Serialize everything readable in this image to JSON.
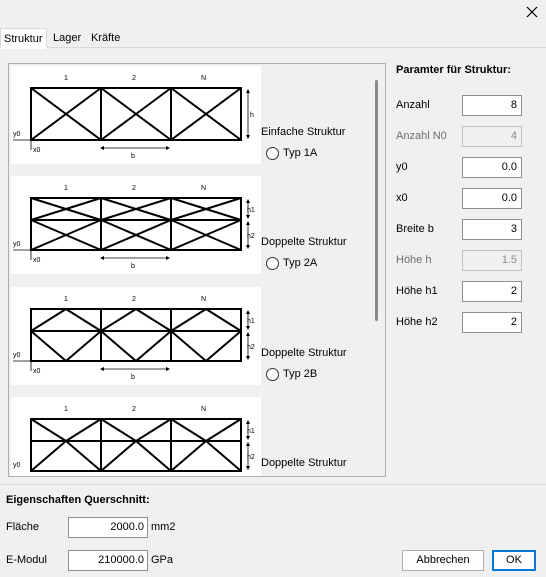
{
  "tabs": [
    {
      "label": "Struktur",
      "active": true
    },
    {
      "label": "Lager",
      "active": false
    },
    {
      "label": "Kräfte",
      "active": false
    }
  ],
  "close_icon": "close-icon",
  "structure_options": [
    {
      "title": "Einfache Struktur",
      "radio_label": "Typ 1A",
      "selected": false,
      "diagram": {
        "cols": [
          "1",
          "2",
          "N"
        ],
        "y0": "y0",
        "x0": "x0",
        "b": "b",
        "heights": [
          "h"
        ]
      }
    },
    {
      "title": "Doppelte Struktur",
      "radio_label": "Typ 2A",
      "selected": false,
      "diagram": {
        "cols": [
          "1",
          "2",
          "N"
        ],
        "y0": "y0",
        "x0": "x0",
        "b": "b",
        "heights": [
          "h1",
          "h2"
        ]
      }
    },
    {
      "title": "Doppelte Struktur",
      "radio_label": "Typ 2B",
      "selected": false,
      "diagram": {
        "cols": [
          "1",
          "2",
          "N"
        ],
        "y0": "y0",
        "x0": "x0",
        "b": "b",
        "heights": [
          "h1",
          "h2"
        ]
      }
    },
    {
      "title": "Doppelte Struktur",
      "radio_label": "",
      "selected": false,
      "diagram": {
        "cols": [
          "1",
          "2",
          "N"
        ],
        "y0": "y0",
        "x0": "",
        "b": "",
        "heights": [
          "h1",
          "h2"
        ]
      }
    }
  ],
  "params": {
    "title": "Paramter für Struktur:",
    "rows": [
      {
        "label": "Anzahl",
        "value": "8",
        "disabled": false
      },
      {
        "label": "Anzahl N0",
        "value": "4",
        "disabled": true
      },
      {
        "label": "y0",
        "value": "0.0",
        "disabled": false
      },
      {
        "label": "x0",
        "value": "0.0",
        "disabled": false
      },
      {
        "label": "Breite b",
        "value": "3",
        "disabled": false
      },
      {
        "label": "Höhe h",
        "value": "1.5",
        "disabled": true
      },
      {
        "label": "Höhe h1",
        "value": "2",
        "disabled": false
      },
      {
        "label": "Höhe h2",
        "value": "2",
        "disabled": false
      }
    ]
  },
  "cross_section": {
    "title": "Eigenschaften Querschnitt:",
    "area_label": "Fläche",
    "area_value": "2000.0",
    "area_unit": "mm2",
    "emod_label": "E-Modul",
    "emod_value": "210000.0",
    "emod_unit": "GPa"
  },
  "buttons": {
    "cancel": "Abbrechen",
    "ok": "OK"
  }
}
